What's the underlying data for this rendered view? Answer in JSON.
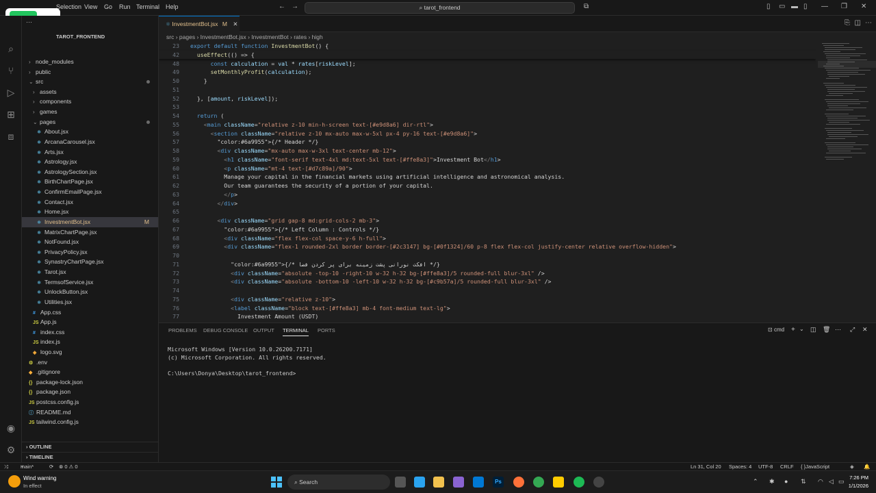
{
  "titlebar": {
    "menus": [
      "Selection",
      "View",
      "Go",
      "Run",
      "Terminal",
      "Help"
    ],
    "search": "tarot_frontend"
  },
  "sidebar": {
    "project": "TAROT_FRONTEND",
    "items": [
      {
        "label": "node_modules",
        "kind": "folder",
        "indent": 1,
        "chev": "›"
      },
      {
        "label": "public",
        "kind": "folder",
        "indent": 1,
        "chev": "›"
      },
      {
        "label": "src",
        "kind": "folder",
        "indent": 1,
        "chev": "⌄"
      },
      {
        "label": "assets",
        "kind": "folder",
        "indent": 2,
        "chev": "›"
      },
      {
        "label": "components",
        "kind": "folder",
        "indent": 2,
        "chev": "›"
      },
      {
        "label": "games",
        "kind": "folder",
        "indent": 2,
        "chev": "›"
      },
      {
        "label": "pages",
        "kind": "folder",
        "indent": 2,
        "chev": "⌄"
      },
      {
        "label": "About.jsx",
        "kind": "jsx",
        "indent": 3
      },
      {
        "label": "ArcanaCarousel.jsx",
        "kind": "jsx",
        "indent": 3
      },
      {
        "label": "Arts.jsx",
        "kind": "jsx",
        "indent": 3
      },
      {
        "label": "Astrology.jsx",
        "kind": "jsx",
        "indent": 3
      },
      {
        "label": "AstrologySection.jsx",
        "kind": "jsx",
        "indent": 3
      },
      {
        "label": "BirthChartPage.jsx",
        "kind": "jsx",
        "indent": 3
      },
      {
        "label": "ConfirmEmailPage.jsx",
        "kind": "jsx",
        "indent": 3
      },
      {
        "label": "Contact.jsx",
        "kind": "jsx",
        "indent": 3
      },
      {
        "label": "Home.jsx",
        "kind": "jsx",
        "indent": 3
      },
      {
        "label": "InvestmentBot.jsx",
        "kind": "jsx",
        "indent": 3,
        "status": "M"
      },
      {
        "label": "MatrixChartPage.jsx",
        "kind": "jsx",
        "indent": 3
      },
      {
        "label": "NotFound.jsx",
        "kind": "jsx",
        "indent": 3
      },
      {
        "label": "PrivacyPolicy.jsx",
        "kind": "jsx",
        "indent": 3
      },
      {
        "label": "SynastryChartPage.jsx",
        "kind": "jsx",
        "indent": 3
      },
      {
        "label": "Tarot.jsx",
        "kind": "jsx",
        "indent": 3
      },
      {
        "label": "TermsofService.jsx",
        "kind": "jsx",
        "indent": 3
      },
      {
        "label": "UnlockButton.jsx",
        "kind": "jsx",
        "indent": 3
      },
      {
        "label": "Utilities.jsx",
        "kind": "jsx",
        "indent": 3
      },
      {
        "label": "App.css",
        "kind": "css",
        "indent": 2
      },
      {
        "label": "App.js",
        "kind": "js",
        "indent": 2
      },
      {
        "label": "index.css",
        "kind": "css",
        "indent": 2
      },
      {
        "label": "index.js",
        "kind": "js",
        "indent": 2
      },
      {
        "label": "logo.svg",
        "kind": "svg",
        "indent": 2
      },
      {
        "label": ".env",
        "kind": "env",
        "indent": 1
      },
      {
        "label": ".gitignore",
        "kind": "git",
        "indent": 1
      },
      {
        "label": "package-lock.json",
        "kind": "json",
        "indent": 1
      },
      {
        "label": "package.json",
        "kind": "json",
        "indent": 1
      },
      {
        "label": "postcss.config.js",
        "kind": "js",
        "indent": 1
      },
      {
        "label": "README.md",
        "kind": "md",
        "indent": 1
      },
      {
        "label": "tailwind.config.js",
        "kind": "js",
        "indent": 1
      }
    ],
    "outline": "OUTLINE",
    "timeline": "TIMELINE"
  },
  "editor": {
    "tab_label": "InvestmentBot.jsx",
    "tab_status": "M",
    "breadcrumb": [
      "src",
      "pages",
      "InvestmentBot.jsx",
      "InvestmentBot",
      "rates",
      "high"
    ],
    "lines": [
      {
        "n": "23",
        "t": "export default function InvestmentBot() {",
        "sticky": true
      },
      {
        "n": "42",
        "t": "  useEffect(() => {",
        "sticky": true
      },
      {
        "n": "48",
        "t": "      const calculation = val * rates[riskLevel];"
      },
      {
        "n": "49",
        "t": "      setMonthlyProfit(calculation);"
      },
      {
        "n": "50",
        "t": "    }"
      },
      {
        "n": "51",
        "t": ""
      },
      {
        "n": "52",
        "t": "  }, [amount, riskLevel]);"
      },
      {
        "n": "53",
        "t": ""
      },
      {
        "n": "54",
        "t": "  return ("
      },
      {
        "n": "55",
        "t": "    <main className=\"relative z-10 min-h-screen text-[#e9d8a6] dir-rtl\">"
      },
      {
        "n": "56",
        "t": "      <section className=\"relative z-10 mx-auto max-w-5xl px-4 py-16 text-[#e9d8a6]\">"
      },
      {
        "n": "57",
        "t": "        {/* Header */}"
      },
      {
        "n": "58",
        "t": "        <div className=\"mx-auto max-w-3xl text-center mb-12\">"
      },
      {
        "n": "59",
        "t": "          <h1 className=\"font-serif text-4xl md:text-5xl text-[#ffe8a3]\">Investment Bot</h1>"
      },
      {
        "n": "60",
        "t": "          <p className=\"mt-4 text-[#d7c89a]/90\">"
      },
      {
        "n": "61",
        "t": "          Manage your capital in the financial markets using artificial intelligence and astronomical analysis."
      },
      {
        "n": "62",
        "t": "          Our team guarantees the security of a portion of your capital."
      },
      {
        "n": "63",
        "t": "          </p>"
      },
      {
        "n": "64",
        "t": "        </div>"
      },
      {
        "n": "65",
        "t": ""
      },
      {
        "n": "66",
        "t": "        <div className=\"grid gap-8 md:grid-cols-2 mb-3\">"
      },
      {
        "n": "67",
        "t": "          {/* Left Column : Controls */}"
      },
      {
        "n": "68",
        "t": "          <div className=\"flex flex-col space-y-6 h-full\">"
      },
      {
        "n": "69",
        "t": "          <div className=\"flex-1 rounded-2xl border border-[#2c3147] bg-[#0f1324]/60 p-8 flex flex-col justify-center relative overflow-hidden\">"
      },
      {
        "n": "70",
        "t": ""
      },
      {
        "n": "71",
        "t": "            {/* افکت نورانی پشت زمینه برای پر کردن فضا */}"
      },
      {
        "n": "72",
        "t": "            <div className=\"absolute -top-10 -right-10 w-32 h-32 bg-[#ffe8a3]/5 rounded-full blur-3xl\" />"
      },
      {
        "n": "73",
        "t": "            <div className=\"absolute -bottom-10 -left-10 w-32 h-32 bg-[#c9b57a]/5 rounded-full blur-3xl\" />"
      },
      {
        "n": "74",
        "t": ""
      },
      {
        "n": "75",
        "t": "            <div className=\"relative z-10\">"
      },
      {
        "n": "76",
        "t": "            <label className=\"block text-[#ffe8a3] mb-4 font-medium text-lg\">"
      },
      {
        "n": "77",
        "t": "              Investment Amount (USDT)"
      }
    ]
  },
  "panel": {
    "tabs": [
      "PROBLEMS",
      "DEBUG CONSOLE",
      "OUTPUT",
      "TERMINAL",
      "PORTS"
    ],
    "active_tab": "TERMINAL",
    "shell": "cmd",
    "terminal_lines": [
      "Microsoft Windows [Version 10.0.26200.7171]",
      "(c) Microsoft Corporation. All rights reserved.",
      "",
      "C:\\Users\\Donya\\Desktop\\tarot_frontend>"
    ]
  },
  "statusbar": {
    "branch": "main*",
    "problems": "⊗ 0 ⚠ 0",
    "position": "Ln 31, Col 20",
    "spaces": "Spaces: 4",
    "encoding": "UTF-8",
    "eol": "CRLF",
    "language": "JavaScript JSX"
  },
  "taskbar": {
    "weather_title": "Wind warning",
    "weather_sub": "In effect",
    "search": "Search",
    "time": "7:26 PM",
    "date": "1/1/2026"
  }
}
